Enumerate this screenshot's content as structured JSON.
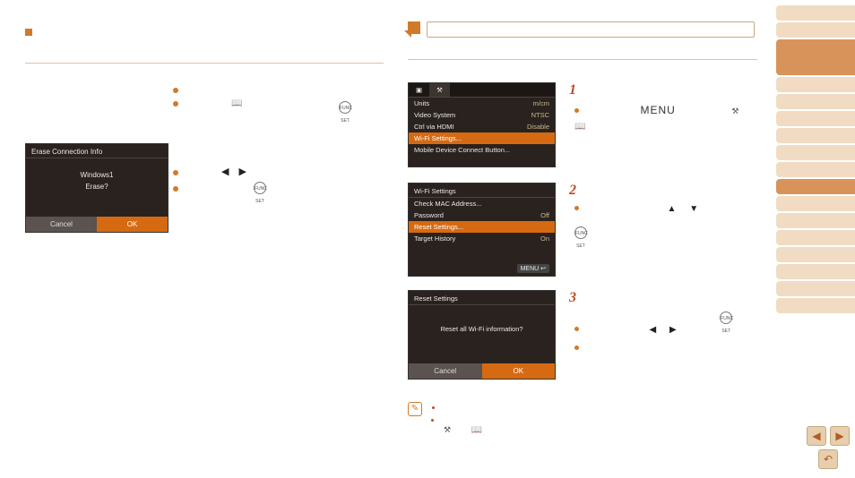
{
  "left": {
    "erase_screen": {
      "title": "Erase Connection Info",
      "device": "Windows1",
      "prompt": "Erase?",
      "cancel": "Cancel",
      "ok": "OK"
    }
  },
  "right": {
    "menu_word": "MENU",
    "screen1": {
      "rows": [
        {
          "label": "Units",
          "value": "m/cm"
        },
        {
          "label": "Video System",
          "value": "NTSC"
        },
        {
          "label": "Ctrl via HDMI",
          "value": "Disable"
        },
        {
          "label": "Wi-Fi Settings...",
          "value": "",
          "sel": true
        },
        {
          "label": "Mobile Device Connect Button...",
          "value": ""
        }
      ]
    },
    "screen2": {
      "title": "Wi-Fi Settings",
      "rows": [
        {
          "label": "Check MAC Address...",
          "value": ""
        },
        {
          "label": "Password",
          "value": "Off"
        },
        {
          "label": "Reset Settings...",
          "value": "",
          "sel": true
        },
        {
          "label": "Target History",
          "value": "On"
        }
      ],
      "foot": "MENU ↩"
    },
    "screen3": {
      "title": "Reset Settings",
      "prompt": "Reset all Wi-Fi information?",
      "cancel": "Cancel",
      "ok": "OK"
    }
  },
  "icons": {
    "func": "FUNC SET"
  },
  "steps": {
    "s1": "1",
    "s2": "2",
    "s3": "3"
  }
}
